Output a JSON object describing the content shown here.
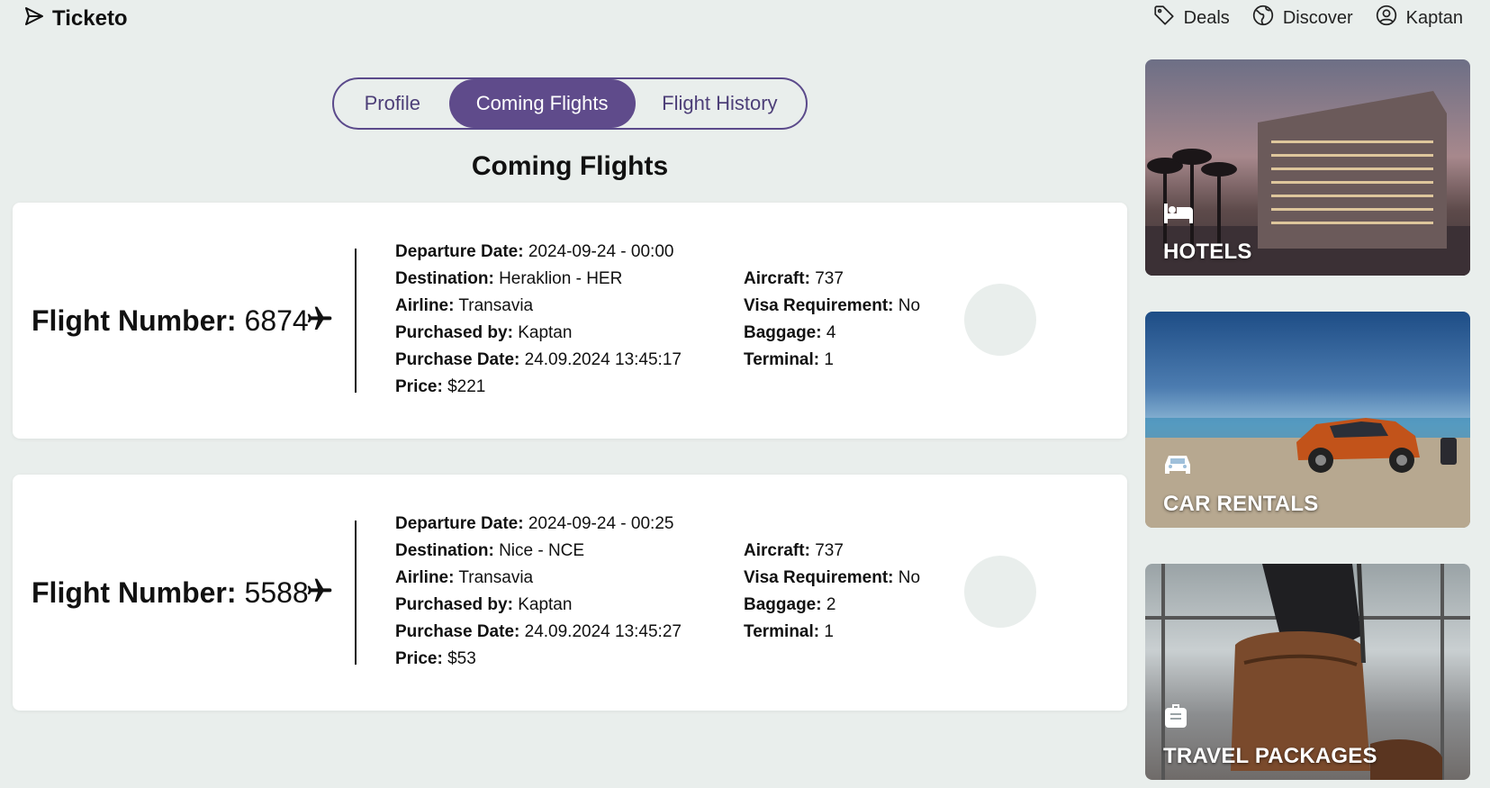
{
  "app": {
    "name": "Ticketo",
    "logo_icon": "send-icon"
  },
  "top_nav": [
    {
      "label": "Deals",
      "icon": "tag-icon"
    },
    {
      "label": "Discover",
      "icon": "globe-icon"
    },
    {
      "label": "Kaptan",
      "icon": "user-circle-icon"
    }
  ],
  "tabs": [
    {
      "label": "Profile",
      "active": false
    },
    {
      "label": "Coming Flights",
      "active": true
    },
    {
      "label": "Flight History",
      "active": false
    }
  ],
  "section_title": "Coming Flights",
  "labels": {
    "flight_number": "Flight Number:",
    "departure_date": "Departure Date:",
    "destination": "Destination:",
    "airline": "Airline:",
    "purchased_by": "Purchased by:",
    "purchase_date": "Purchase Date:",
    "price": "Price:",
    "aircraft": "Aircraft:",
    "visa_requirement": "Visa Requirement:",
    "baggage": "Baggage:",
    "terminal": "Terminal:"
  },
  "flights": [
    {
      "flight_number": "6874",
      "departure_date": "2024-09-24 - 00:00",
      "destination": "Heraklion - HER",
      "airline": "Transavia",
      "purchased_by": "Kaptan",
      "purchase_date": "24.09.2024 13:45:17",
      "price": "$221",
      "aircraft": "737",
      "visa_requirement": "No",
      "baggage": "4",
      "terminal": "1"
    },
    {
      "flight_number": "5588",
      "departure_date": "2024-09-24 - 00:25",
      "destination": "Nice - NCE",
      "airline": "Transavia",
      "purchased_by": "Kaptan",
      "purchase_date": "24.09.2024 13:45:27",
      "price": "$53",
      "aircraft": "737",
      "visa_requirement": "No",
      "baggage": "2",
      "terminal": "1"
    }
  ],
  "promos": [
    {
      "label": "HOTELS",
      "icon": "bed-icon"
    },
    {
      "label": "CAR RENTALS",
      "icon": "car-icon"
    },
    {
      "label": "TRAVEL PACKAGES",
      "icon": "suitcase-icon"
    }
  ],
  "colors": {
    "accent": "#5f4b8b",
    "background": "#e9eeec",
    "card": "#ffffff"
  }
}
